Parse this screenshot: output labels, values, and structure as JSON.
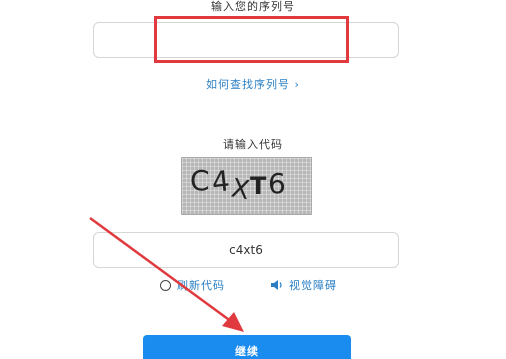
{
  "serial_section": {
    "label": "输入您的序列号",
    "input_value": "",
    "help_link": "如何查找序列号 ›"
  },
  "code_section": {
    "label": "请输入代码",
    "captcha_text": "C4XT6",
    "input_value": "c4xt6",
    "refresh_label": "刷新代码",
    "audio_label": "视觉障碍"
  },
  "continue_button": {
    "label": "继续"
  },
  "colors": {
    "accent": "#1a8cf0",
    "link": "#2a7fc4",
    "annotation": "#e03a3e"
  }
}
